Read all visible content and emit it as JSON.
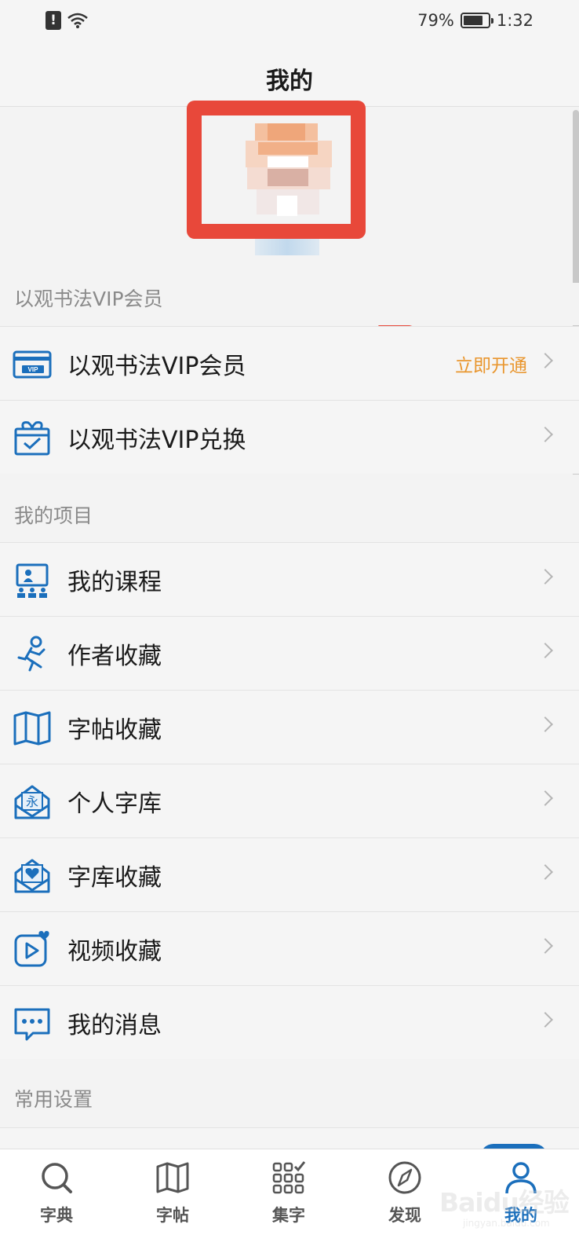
{
  "status_bar": {
    "battery": "79%",
    "time": "1:32",
    "sim": "!"
  },
  "header": {
    "title": "我的"
  },
  "sections": {
    "vip": "以观书法VIP会员",
    "projects": "我的项目",
    "settings": "常用设置"
  },
  "vip_rows": [
    {
      "label": "以观书法VIP会员",
      "action": "立即开通",
      "icon": "vip-card-icon"
    },
    {
      "label": "以观书法VIP兑换",
      "icon": "gift-box-icon"
    }
  ],
  "project_rows": [
    {
      "label": "我的课程",
      "icon": "course-icon"
    },
    {
      "label": "作者收藏",
      "icon": "author-icon"
    },
    {
      "label": "字帖收藏",
      "icon": "map-book-icon"
    },
    {
      "label": "个人字库",
      "icon": "personal-library-icon"
    },
    {
      "label": "字库收藏",
      "icon": "library-favorite-icon"
    },
    {
      "label": "视频收藏",
      "icon": "video-favorite-icon"
    },
    {
      "label": "我的消息",
      "icon": "message-icon"
    }
  ],
  "tabs": [
    {
      "label": "字典",
      "icon": "search-icon"
    },
    {
      "label": "字帖",
      "icon": "map-icon"
    },
    {
      "label": "集字",
      "icon": "grid-check-icon"
    },
    {
      "label": "发现",
      "icon": "compass-icon"
    },
    {
      "label": "我的",
      "icon": "user-icon",
      "active": true
    }
  ],
  "colors": {
    "accent": "#1b6fbc",
    "highlight": "#e8483a",
    "action": "#e9962e"
  },
  "watermark": {
    "text": "Baidu经验",
    "sub": "jingyan.baidu.com"
  }
}
